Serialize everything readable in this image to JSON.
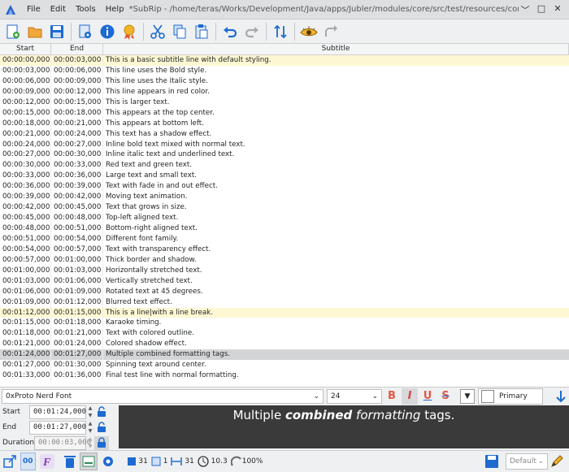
{
  "window": {
    "title": "*SubRip - /home/teras/Works/Development/Java/apps/Jubler/modules/core/src/test/resources/comprehensive.srt - Jubler",
    "menu": [
      "File",
      "Edit",
      "Tools",
      "Help"
    ],
    "controls": [
      "﹀",
      "□",
      "✕"
    ]
  },
  "table": {
    "headers": {
      "start": "Start",
      "end": "End",
      "subtitle": "Subtitle"
    },
    "rows": [
      {
        "start": "00:00:00,000",
        "end": "00:00:03,000",
        "text": "This is a basic subtitle line with default styling.",
        "state": "hl"
      },
      {
        "start": "00:00:03,000",
        "end": "00:00:06,000",
        "text": "This line uses the Bold style.",
        "state": ""
      },
      {
        "start": "00:00:06,000",
        "end": "00:00:09,000",
        "text": "This line uses the Italic style.",
        "state": ""
      },
      {
        "start": "00:00:09,000",
        "end": "00:00:12,000",
        "text": "This line appears in red color.",
        "state": ""
      },
      {
        "start": "00:00:12,000",
        "end": "00:00:15,000",
        "text": "This is larger text.",
        "state": ""
      },
      {
        "start": "00:00:15,000",
        "end": "00:00:18,000",
        "text": "This appears at the top center.",
        "state": ""
      },
      {
        "start": "00:00:18,000",
        "end": "00:00:21,000",
        "text": "This appears at bottom left.",
        "state": ""
      },
      {
        "start": "00:00:21,000",
        "end": "00:00:24,000",
        "text": "This text has a shadow effect.",
        "state": ""
      },
      {
        "start": "00:00:24,000",
        "end": "00:00:27,000",
        "text": "Inline bold text mixed with normal text.",
        "state": ""
      },
      {
        "start": "00:00:27,000",
        "end": "00:00:30,000",
        "text": "Inline italic text and underlined text.",
        "state": ""
      },
      {
        "start": "00:00:30,000",
        "end": "00:00:33,000",
        "text": "Red text and green text.",
        "state": ""
      },
      {
        "start": "00:00:33,000",
        "end": "00:00:36,000",
        "text": "Large text and small text.",
        "state": ""
      },
      {
        "start": "00:00:36,000",
        "end": "00:00:39,000",
        "text": "Text with fade in and out effect.",
        "state": ""
      },
      {
        "start": "00:00:39,000",
        "end": "00:00:42,000",
        "text": "Moving text animation.",
        "state": ""
      },
      {
        "start": "00:00:42,000",
        "end": "00:00:45,000",
        "text": "Text that grows in size.",
        "state": ""
      },
      {
        "start": "00:00:45,000",
        "end": "00:00:48,000",
        "text": "Top-left aligned text.",
        "state": ""
      },
      {
        "start": "00:00:48,000",
        "end": "00:00:51,000",
        "text": "Bottom-right aligned text.",
        "state": ""
      },
      {
        "start": "00:00:51,000",
        "end": "00:00:54,000",
        "text": "Different font family.",
        "state": ""
      },
      {
        "start": "00:00:54,000",
        "end": "00:00:57,000",
        "text": "Text with transparency effect.",
        "state": ""
      },
      {
        "start": "00:00:57,000",
        "end": "00:01:00,000",
        "text": "Thick border and shadow.",
        "state": ""
      },
      {
        "start": "00:01:00,000",
        "end": "00:01:03,000",
        "text": "Horizontally stretched text.",
        "state": ""
      },
      {
        "start": "00:01:03,000",
        "end": "00:01:06,000",
        "text": "Vertically stretched text.",
        "state": ""
      },
      {
        "start": "00:01:06,000",
        "end": "00:01:09,000",
        "text": "Rotated text at 45 degrees.",
        "state": ""
      },
      {
        "start": "00:01:09,000",
        "end": "00:01:12,000",
        "text": "Blurred text effect.",
        "state": ""
      },
      {
        "start": "00:01:12,000",
        "end": "00:01:15,000",
        "text": "This is a line|with a line break.",
        "state": "hl"
      },
      {
        "start": "00:01:15,000",
        "end": "00:01:18,000",
        "text": "Karaoke timing.",
        "state": ""
      },
      {
        "start": "00:01:18,000",
        "end": "00:01:21,000",
        "text": "Text with colored outline.",
        "state": ""
      },
      {
        "start": "00:01:21,000",
        "end": "00:01:24,000",
        "text": "Colored shadow effect.",
        "state": ""
      },
      {
        "start": "00:01:24,000",
        "end": "00:01:27,000",
        "text": "Multiple combined formatting tags.",
        "state": "sel"
      },
      {
        "start": "00:01:27,000",
        "end": "00:01:30,000",
        "text": "Spinning text around center.",
        "state": ""
      },
      {
        "start": "00:01:33,000",
        "end": "00:01:36,000",
        "text": "Final test line with normal formatting.",
        "state": ""
      }
    ]
  },
  "editor": {
    "font": "0xProto Nerd Font",
    "size": "24",
    "style": "Primary",
    "start_label": "Start",
    "end_label": "End",
    "duration_label": "Duration",
    "start_value": "00:01:24,000",
    "end_value": "00:01:27,000",
    "duration_value": "00:00:03,000",
    "preview": {
      "a": "Multiple ",
      "b": "combined",
      "c": " ",
      "d": "formatting",
      "e": " tags."
    }
  },
  "status": {
    "mode": "00",
    "count_a": "31",
    "count_b": "1",
    "count_c": "31",
    "fps": "10.3",
    "zoom": "100%",
    "default": "Default"
  },
  "colors": {
    "highlight": "#fdf8d3",
    "selected": "#d4d5d6",
    "accent": "#1d6ad1",
    "preview_bg": "#3a3a3a"
  }
}
